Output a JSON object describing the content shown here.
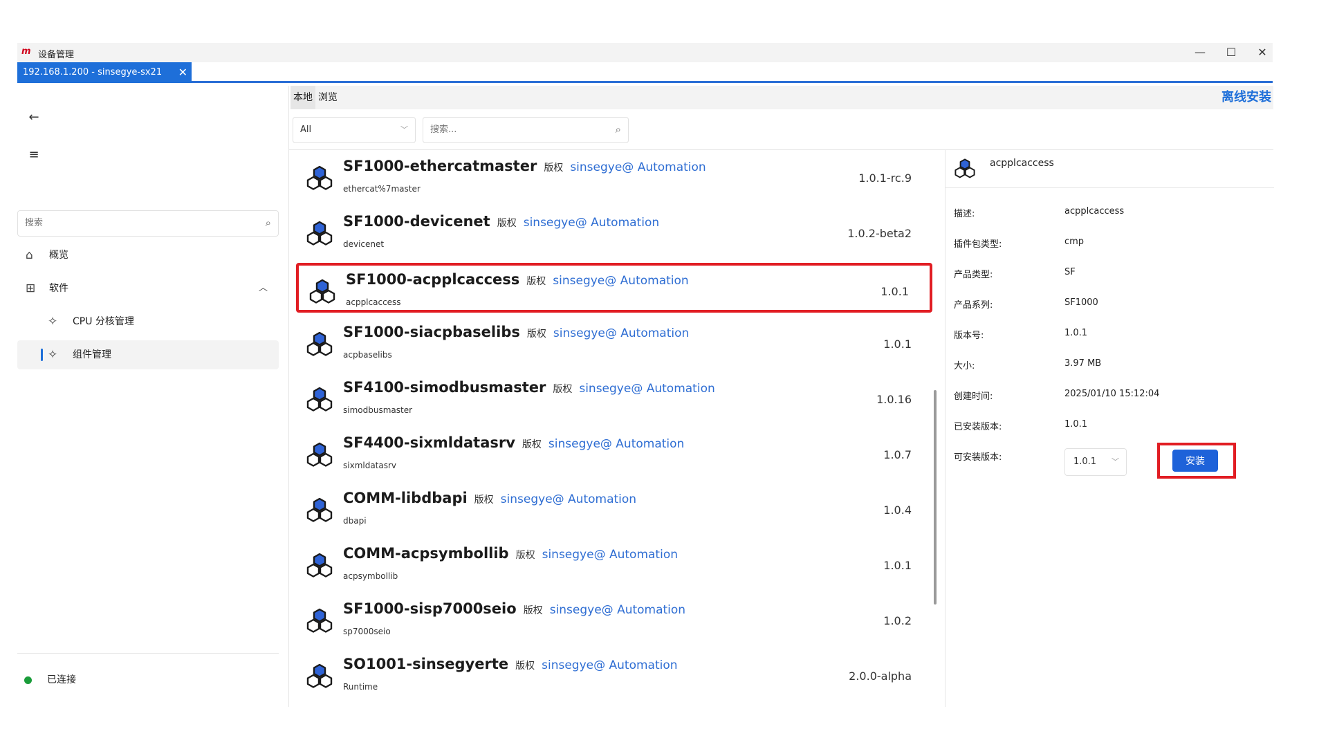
{
  "window": {
    "logo_text": "m",
    "title": "设备管理",
    "minimize_glyph": "—",
    "maximize_glyph": "☐",
    "close_glyph": "✕"
  },
  "tab": {
    "label": "192.168.1.200 - sinsegye-sx21",
    "close_glyph": "✕"
  },
  "sidebar": {
    "search_placeholder": "搜索",
    "items": [
      {
        "label": "概览",
        "icon": "home-icon"
      },
      {
        "label": "软件",
        "icon": "grid-icon",
        "expanded": true
      },
      {
        "label": "CPU 分核管理",
        "icon": "puzzle-icon"
      },
      {
        "label": "组件管理",
        "icon": "puzzle-icon",
        "active": true
      }
    ],
    "status": "已连接",
    "status_color": "#1a9c3a"
  },
  "main": {
    "tabs": [
      "本地",
      "浏览"
    ],
    "offline_install": "离线安装",
    "filter_value": "All",
    "search_placeholder": "搜索..."
  },
  "packages": [
    {
      "name": "SF1000-ethercatmaster",
      "rights": "版权",
      "author": "sinsegye@ Automation",
      "id": "ethercat%7master",
      "version": "1.0.1-rc.9"
    },
    {
      "name": "SF1000-devicenet",
      "rights": "版权",
      "author": "sinsegye@ Automation",
      "id": "devicenet",
      "version": "1.0.2-beta2"
    },
    {
      "name": "SF1000-acpplcaccess",
      "rights": "版权",
      "author": "sinsegye@ Automation",
      "id": "acpplcaccess",
      "version": "1.0.1",
      "selected": true
    },
    {
      "name": "SF1000-siacpbaselibs",
      "rights": "版权",
      "author": "sinsegye@ Automation",
      "id": "acpbaselibs",
      "version": "1.0.1"
    },
    {
      "name": "SF4100-simodbusmaster",
      "rights": "版权",
      "author": "sinsegye@ Automation",
      "id": "simodbusmaster",
      "version": "1.0.16"
    },
    {
      "name": "SF4400-sixmldatasrv",
      "rights": "版权",
      "author": "sinsegye@ Automation",
      "id": "sixmldatasrv",
      "version": "1.0.7"
    },
    {
      "name": "COMM-libdbapi",
      "rights": "版权",
      "author": "sinsegye@ Automation",
      "id": "dbapi",
      "version": "1.0.4"
    },
    {
      "name": "COMM-acpsymbollib",
      "rights": "版权",
      "author": "sinsegye@ Automation",
      "id": "acpsymbollib",
      "version": "1.0.1"
    },
    {
      "name": "SF1000-sisp7000seio",
      "rights": "版权",
      "author": "sinsegye@ Automation",
      "id": "sp7000seio",
      "version": "1.0.2"
    },
    {
      "name": "SO1001-sinsegyerte",
      "rights": "版权",
      "author": "sinsegye@ Automation",
      "id": "Runtime",
      "version": "2.0.0-alpha"
    }
  ],
  "detail": {
    "name": "acpplcaccess",
    "rows": [
      {
        "k": "描述:",
        "v": "acpplcaccess"
      },
      {
        "k": "插件包类型:",
        "v": "cmp"
      },
      {
        "k": "产品类型:",
        "v": "SF"
      },
      {
        "k": "产品系列:",
        "v": "SF1000"
      },
      {
        "k": "版本号:",
        "v": "1.0.1"
      },
      {
        "k": "大小:",
        "v": "3.97 MB"
      },
      {
        "k": "创建时间:",
        "v": "2025/01/10 15:12:04"
      },
      {
        "k": "已安装版本:",
        "v": "1.0.1"
      },
      {
        "k": "可安装版本:",
        "v": ""
      }
    ],
    "installable_version": "1.0.1",
    "install_label": "安装"
  },
  "colors": {
    "accent": "#1e6fd9",
    "highlight": "#e11d23",
    "author": "#2f6ed3"
  }
}
